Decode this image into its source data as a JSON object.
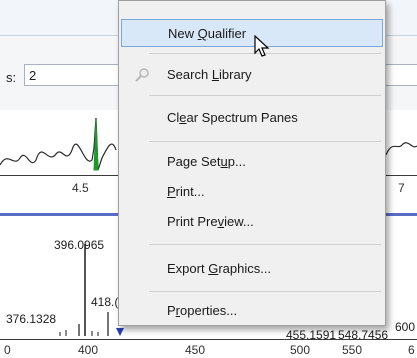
{
  "top": {
    "field_label": "s:",
    "field_value": "2"
  },
  "plot1": {
    "ticks": [
      "4.5",
      "7"
    ]
  },
  "plot2": {
    "peaks": [
      {
        "label": "396.0965"
      },
      {
        "label": "418.("
      },
      {
        "label": "376.1328"
      },
      {
        "label": "455.1591"
      },
      {
        "label": "548.7456"
      },
      {
        "label": "600"
      }
    ],
    "axis_ticks": [
      "0",
      "400",
      "450",
      "500",
      "550",
      "6"
    ]
  },
  "menu": {
    "items": [
      {
        "pre": "New ",
        "u": "Q",
        "post": "ualifier",
        "highlighted": true
      },
      {
        "pre": "Search ",
        "u": "L",
        "post": "ibrary",
        "icon": "search-library-icon"
      },
      {
        "pre": "Cl",
        "u": "e",
        "post": "ar Spectrum Panes"
      },
      {
        "pre": "Page Set",
        "u": "u",
        "post": "p..."
      },
      {
        "pre": "",
        "u": "P",
        "post": "rint..."
      },
      {
        "pre": "Print Pre",
        "u": "v",
        "post": "iew..."
      },
      {
        "pre": "Export ",
        "u": "G",
        "post": "raphics..."
      },
      {
        "pre": "P",
        "u": "r",
        "post": "operties..."
      }
    ]
  },
  "colors": {
    "highlight": "#d8e8f8",
    "spectrum_green": "#1a9a2a",
    "band_blue": "#5a6cc7"
  }
}
